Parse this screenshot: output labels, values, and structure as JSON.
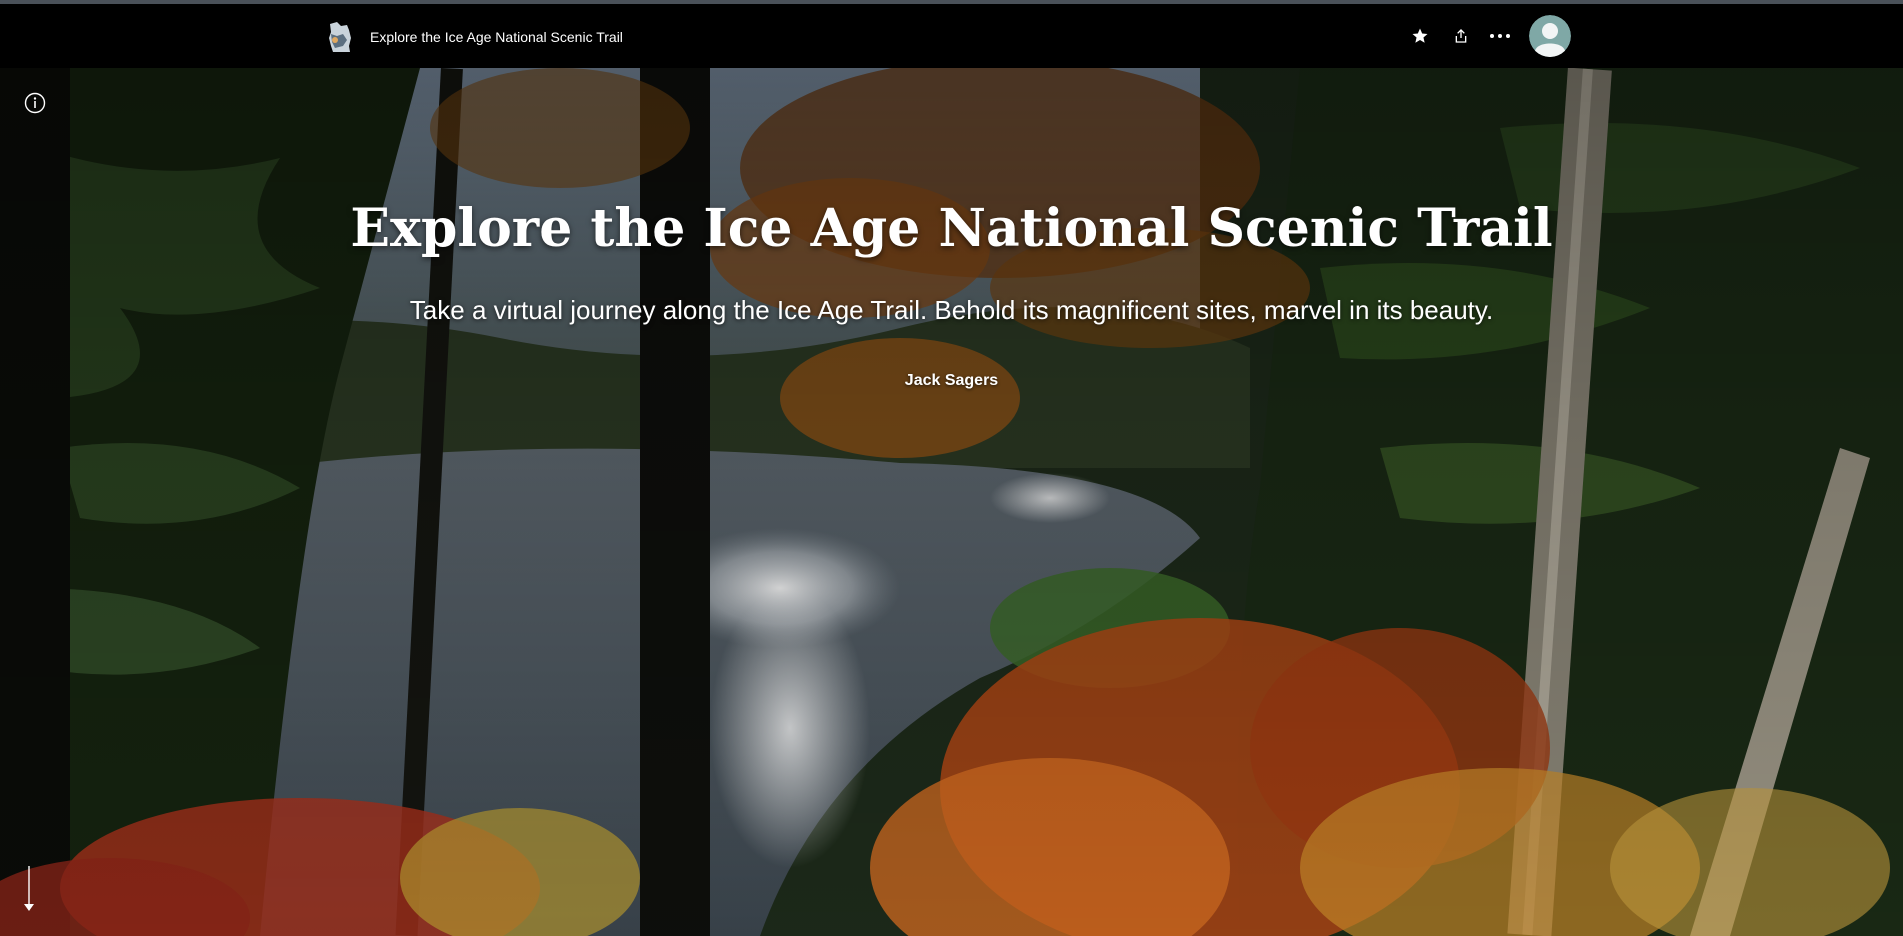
{
  "header": {
    "title": "Explore the Ice Age National Scenic Trail",
    "logo_icon": "wisconsin-map-logo",
    "actions": [
      {
        "name": "favorite",
        "icon": "star-icon"
      },
      {
        "name": "share",
        "icon": "share-icon"
      },
      {
        "name": "more",
        "icon": "ellipsis-icon"
      }
    ],
    "avatar_icon": "user-avatar-icon"
  },
  "hero": {
    "title": "Explore the Ice Age National Scenic Trail",
    "subtitle": "Take a virtual journey along the Ice Age Trail. Behold its magnificent sites, marvel in its beauty.",
    "byline": "Jack Sagers",
    "background": "autumn forest overlooking a lake"
  },
  "controls": {
    "info_icon": "info-icon",
    "scroll_icon": "arrow-down-icon"
  },
  "colors": {
    "header_bg": "#000000",
    "top_line": "#4a5159",
    "avatar_bg": "#7fa8a6",
    "text": "#ffffff"
  }
}
